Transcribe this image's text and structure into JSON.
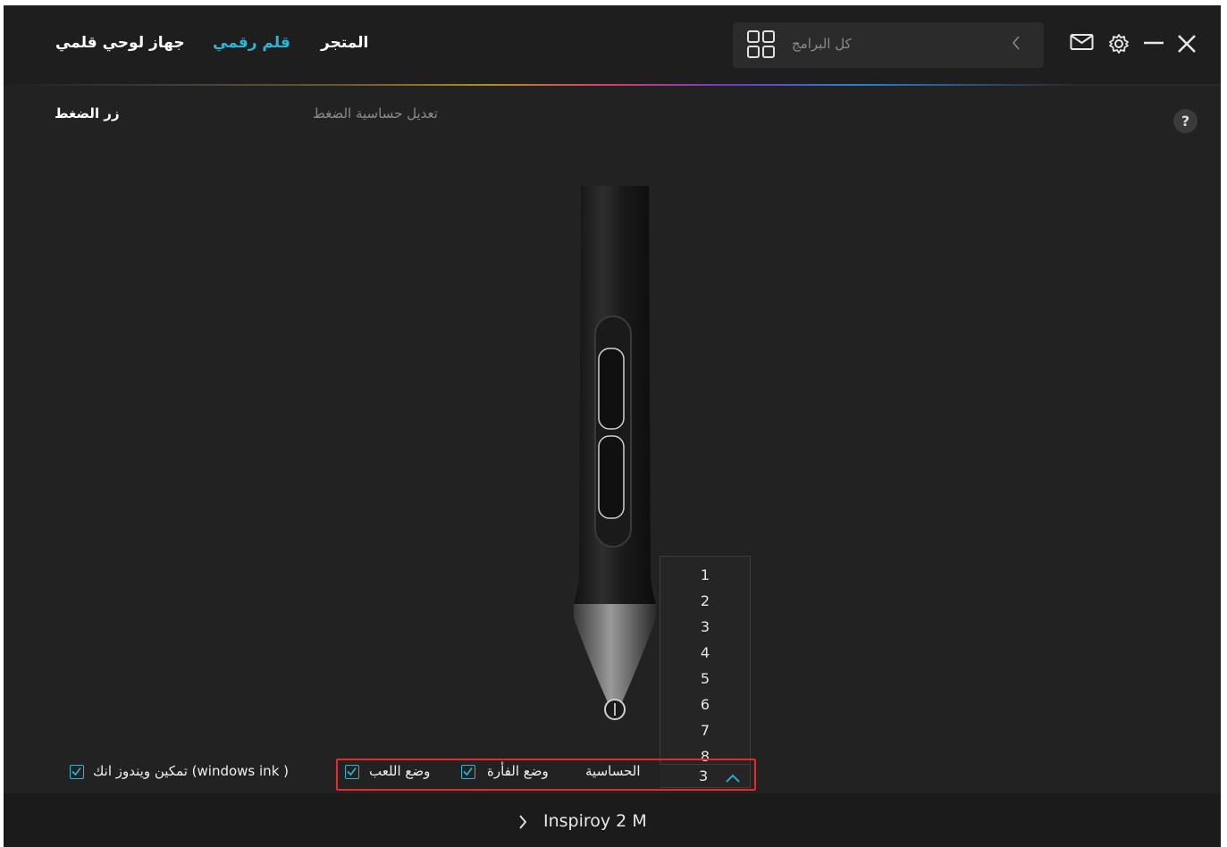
{
  "nav": {
    "tabs": [
      {
        "label": "جهاز لوحي قلمي"
      },
      {
        "label": "قلم رقمي"
      },
      {
        "label": "المتجر"
      }
    ]
  },
  "search": {
    "placeholder": "كل البرامج"
  },
  "subheader": {
    "pen_buttons": "زر الضغط",
    "pressure_sensitivity": "تعديل حساسية الضغط"
  },
  "help": {
    "label": "?"
  },
  "dropdown": {
    "options": [
      "1",
      "2",
      "3",
      "4",
      "5",
      "6",
      "7",
      "8"
    ],
    "selected": "3"
  },
  "options": {
    "windows_ink": "تمكين ويندوز انك (windows ink )",
    "game_mode": "وضع اللعب",
    "mouse_mode": "وضع الفأرة",
    "sensitivity": "الحساسية"
  },
  "footer": {
    "device": "Inspiroy 2 M"
  },
  "colors": {
    "accent": "#29b6d8",
    "highlight": "#e8282b",
    "background": "#222222"
  }
}
